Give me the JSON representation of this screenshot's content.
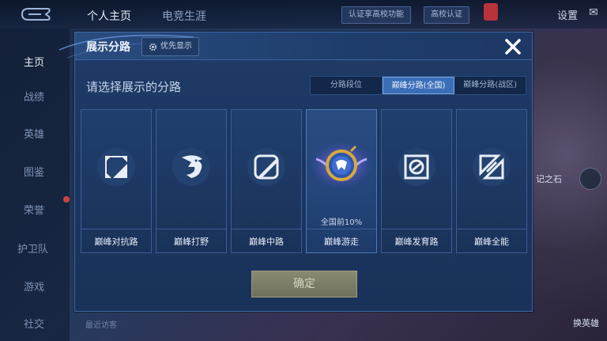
{
  "topbar": {
    "tabs": [
      "个人主页",
      "电竞生涯"
    ],
    "tags": [
      "认证享高校功能",
      "高校认证"
    ],
    "promo_text": "",
    "settings_label": "设置"
  },
  "sidebar": {
    "items": [
      "主页",
      "战绩",
      "英雄",
      "图鉴",
      "荣誉",
      "护卫队",
      "游戏",
      "社交"
    ],
    "recent_visitors": "最近访客"
  },
  "right_panel": {
    "labels": [
      "记之石",
      "换英雄"
    ]
  },
  "modal": {
    "title": "展示分路",
    "priority_label": "优先显示",
    "subtitle": "请选择展示的分路",
    "segments": [
      "分路段位",
      "巅峰分路(全国)",
      "巅峰分路(战区)"
    ],
    "active_segment": 1,
    "cards": [
      {
        "name": "巅峰对抗路",
        "icon": "clash-lane-icon"
      },
      {
        "name": "巅峰打野",
        "icon": "jungle-icon"
      },
      {
        "name": "巅峰中路",
        "icon": "mid-lane-icon"
      },
      {
        "name": "巅峰游走",
        "icon": "roam-badge-icon",
        "rank": "全国前10%"
      },
      {
        "name": "巅峰发育路",
        "icon": "farm-lane-icon"
      },
      {
        "name": "巅峰全能",
        "icon": "all-round-icon"
      }
    ],
    "confirm_label": "确定"
  },
  "colors": {
    "modal_bg": "#1f3b66",
    "accent_blue": "#3a6fb8",
    "gold": "#d9a93a",
    "confirm_bg": "#8a8a72"
  }
}
